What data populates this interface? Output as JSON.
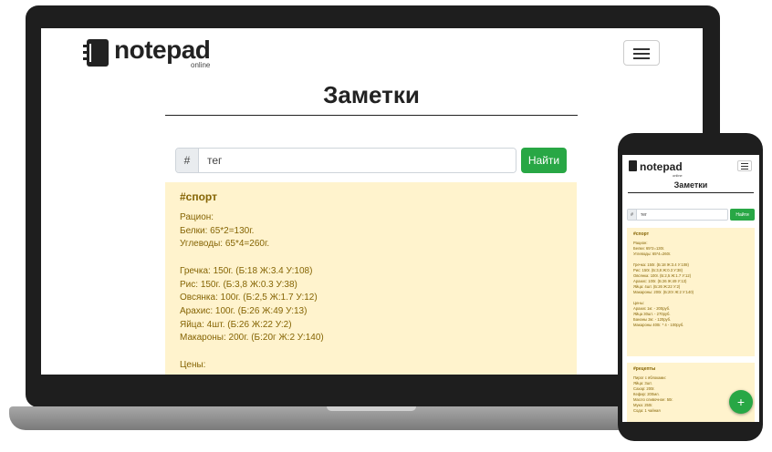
{
  "brand": {
    "name": "notepad",
    "sub": "online"
  },
  "page_title": "Заметки",
  "search": {
    "prefix": "#",
    "value": "тег",
    "button": "Найти"
  },
  "notes": [
    {
      "tag": "#спорт",
      "lines": [
        "Рацион:",
        "Белки: 65*2=130г.",
        "Углеводы: 65*4=260г.",
        "",
        "Гречка: 150г. (Б:18 Ж:3.4 У:108)",
        "Рис: 150г. (Б:3,8 Ж:0.3 У:38)",
        "Овсянка: 100г. (Б:2,5 Ж:1.7 У:12)",
        "Арахис: 100г. (Б:26 Ж:49 У:13)",
        "Яйца: 4шт. (Б:26 Ж:22 У:2)",
        "Макароны: 200г. (Б:20г Ж:2 У:140)",
        "",
        "Цены:"
      ]
    }
  ],
  "phone": {
    "notes": [
      {
        "tag": "#спорт",
        "lines": [
          "Рацион:",
          "Белки: 65*2=130г.",
          "Углеводы: 65*4=260г.",
          "",
          "Гречка: 150г. (Б:18 Ж:3.4 У:108)",
          "Рис: 150г. (Б:3,8 Ж:0.3 У:38)",
          "Овсянка: 100г. (Б:2,5 Ж:1.7 У:12)",
          "Арахис: 100г. (Б:26 Ж:49 У:13)",
          "Яйца: 4шт. (Б:26 Ж:22 У:2)",
          "Макароны: 200г. (Б:20г Ж:2 У:140)",
          "",
          "Цены:",
          "Арахис 1кг. - 200руб.",
          "Яйца 30шт. - 270руб.",
          "Бананы 2кг. - 120руб.",
          "Макароны 400г. * 4 - 100руб."
        ]
      },
      {
        "tag": "#рецепты",
        "lines": [
          "Пирог с яблоками:",
          "Яйца: 3шт.",
          "Сахар: 200г.",
          "Кефир: 200мл.",
          "Масло сливочное: 50г.",
          "Мука: 250г.",
          "Сода: 1 чайная"
        ]
      }
    ],
    "fab": "+"
  }
}
